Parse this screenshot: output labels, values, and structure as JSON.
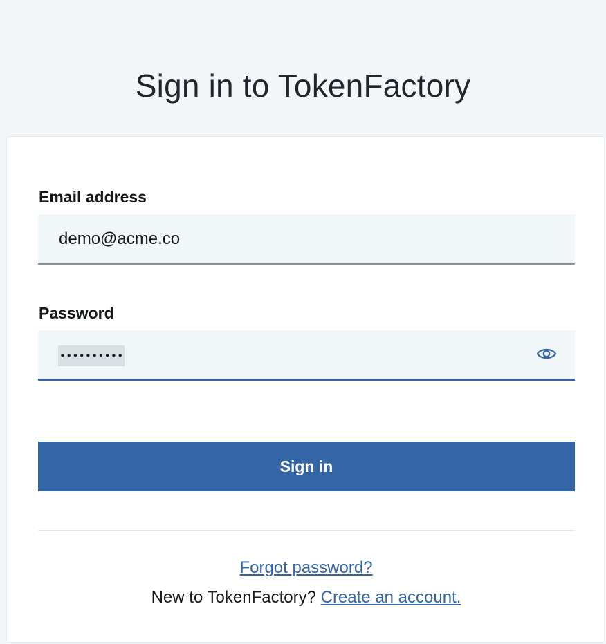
{
  "page": {
    "title": "Sign in to TokenFactory"
  },
  "form": {
    "email_label": "Email address",
    "email_value": "demo@acme.co",
    "password_label": "Password",
    "password_mask": "••••••••••",
    "password_type": "password",
    "show_password_icon": "eye-icon",
    "submit_label": "Sign in"
  },
  "footer": {
    "forgot_link": "Forgot password?",
    "new_user_text": "New to TokenFactory?",
    "create_account_link": "Create an account."
  },
  "colors": {
    "accent": "#3466a7",
    "page_background": "#f2f6f9",
    "field_background": "#f1f6f9",
    "card_background": "#ffffff"
  }
}
